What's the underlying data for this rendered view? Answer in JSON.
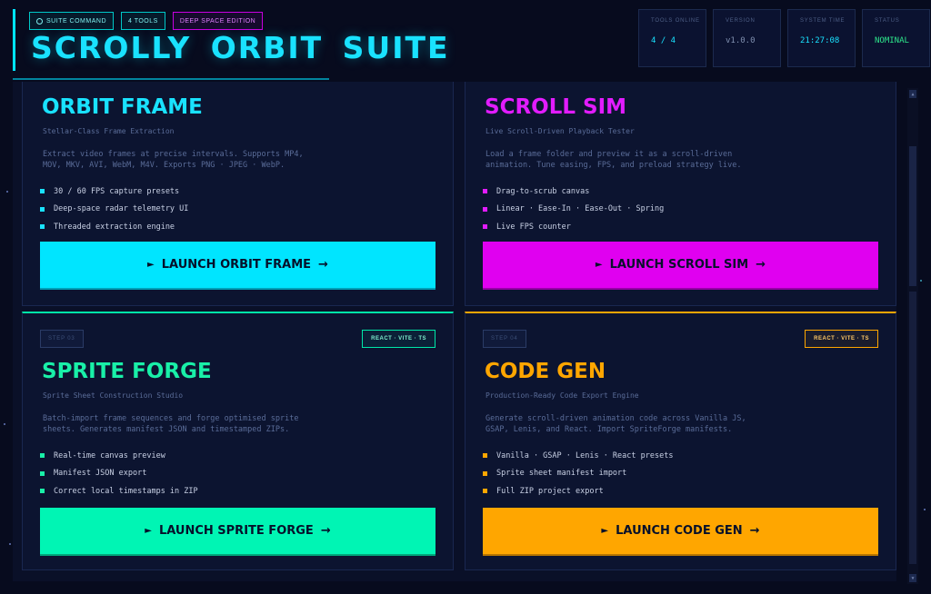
{
  "header": {
    "tags": [
      "SUITE COMMAND",
      "4 TOOLS",
      "DEEP SPACE EDITION"
    ],
    "title": "SCROLLY ORBIT SUITE",
    "stats": [
      {
        "label": "TOOLS ONLINE",
        "value": "4 / 4"
      },
      {
        "label": "VERSION",
        "value": "v1.0.0"
      },
      {
        "label": "SYSTEM TIME",
        "value": "21:27:08"
      },
      {
        "label": "STATUS",
        "value": "NOMINAL"
      }
    ]
  },
  "cards": [
    {
      "title": "ORBIT FRAME",
      "subtitle": "Stellar-Class Frame Extraction",
      "description": "Extract video frames at precise intervals. Supports MP4,\nMOV, MKV, AVI, WebM, M4V. Exports PNG · JPEG · WebP.",
      "features": [
        "30 / 60 FPS capture presets",
        "Deep-space radar telemetry UI",
        "Threaded extraction engine"
      ],
      "button": "LAUNCH ORBIT FRAME",
      "accent": "#00e5ff"
    },
    {
      "title": "SCROLL SIM",
      "subtitle": "Live Scroll-Driven Playback Tester",
      "description": "Load a frame folder and preview it as a scroll-driven\nanimation. Tune easing, FPS, and preload strategy live.",
      "features": [
        "Drag-to-scrub canvas",
        "Linear · Ease-In · Ease-Out · Spring",
        "Live FPS counter"
      ],
      "button": "LAUNCH SCROLL SIM",
      "accent": "#e000f0"
    },
    {
      "step": "STEP 03",
      "stack": "REACT · VITE · TS",
      "title": "SPRITE FORGE",
      "subtitle": "Sprite Sheet Construction Studio",
      "description": "Batch-import frame sequences and forge optimised sprite\nsheets. Generates manifest JSON and timestamped ZIPs.",
      "features": [
        "Real-time canvas preview",
        "Manifest JSON export",
        "Correct local timestamps in ZIP"
      ],
      "button": "LAUNCH SPRITE FORGE",
      "accent": "#00f5b4"
    },
    {
      "step": "STEP 04",
      "stack": "REACT · VITE · TS",
      "title": "CODE GEN",
      "subtitle": "Production-Ready Code Export Engine",
      "description": "Generate scroll-driven animation code across Vanilla JS,\nGSAP, Lenis, and React. Import SpriteForge manifests.",
      "features": [
        "Vanilla · GSAP · Lenis · React presets",
        "Sprite sheet manifest import",
        "Full ZIP project export"
      ],
      "button": "LAUNCH CODE GEN",
      "accent": "#ffa600"
    }
  ],
  "icons": {
    "play": "►",
    "arrow": "→",
    "scroll_up": "▲",
    "scroll_down": "▼"
  }
}
